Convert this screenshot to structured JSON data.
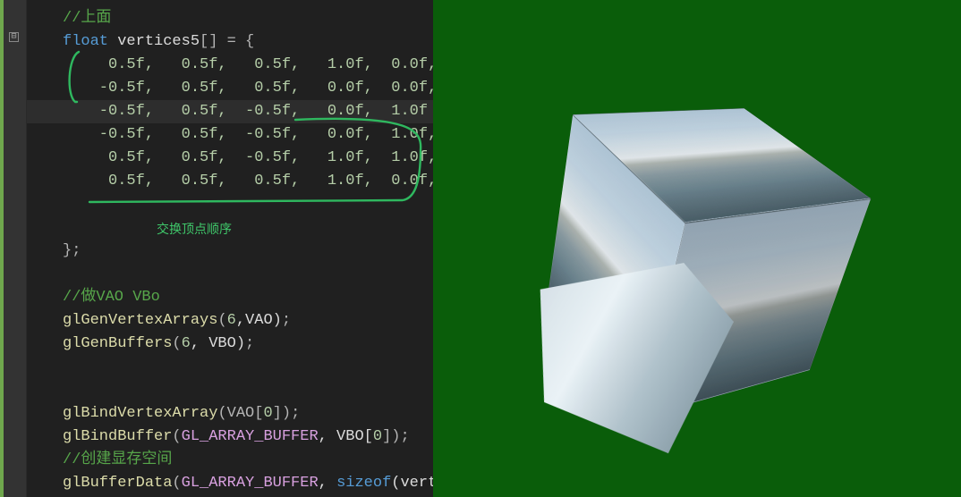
{
  "editor": {
    "fold_glyph": "⊟",
    "annotation": "交换顶点顺序",
    "lines": {
      "l1_comment": "//上面",
      "l2_kw": "float",
      "l2_ident": " vertices5",
      "l2_rest": "[] = {",
      "r1": "     0.5f,   0.5f,   0.5f,   1.0f,  0.0f,",
      "r2": "    -0.5f,   0.5f,   0.5f,   0.0f,  0.0f,",
      "r3": "    -0.5f,   0.5f,  -0.5f,   0.0f,  1.0f",
      "r4": "    -0.5f,   0.5f,  -0.5f,   0.0f,  1.0f,",
      "r5": "     0.5f,   0.5f,  -0.5f,   1.0f,  1.0f,",
      "r6": "     0.5f,   0.5f,   0.5f,   1.0f,  0.0f,",
      "close": "};",
      "c1": "//做VAO VBo",
      "f1a": "glGenVertexArrays",
      "f1b": "(",
      "f1c": "6",
      "f1d": ",VAO)",
      "f1e": ";",
      "f2a": "glGenBuffers",
      "f2b": "(",
      "f2c": "6",
      "f2d": ", VBO)",
      "f2e": ";",
      "f3a": "glBindVertexArray",
      "f3b": "(VAO[",
      "f3c": "0",
      "f3d": "])",
      "f3e": ";",
      "f4a": "glBindBuffer",
      "f4b": "(",
      "f4c": "GL_ARRAY_BUFFER",
      "f4d": ", VBO[",
      "f4e": "0",
      "f4f": "])",
      "f4g": ";",
      "c2": "//创建显存空间",
      "f5a": "glBufferData",
      "f5b": "(",
      "f5c": "GL_ARRAY_BUFFER",
      "f5d": ", ",
      "f5e": "sizeof",
      "f5f": "(vert"
    }
  },
  "render": {
    "background": "#0a5d0a"
  }
}
